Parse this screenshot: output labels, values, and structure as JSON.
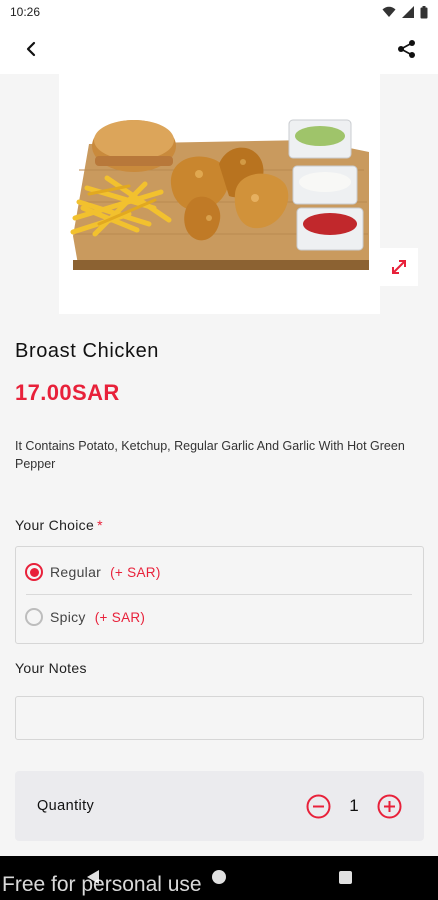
{
  "status_bar": {
    "time": "10:26"
  },
  "product": {
    "name": "Broast Chicken",
    "price": "17.00SAR",
    "description": "It Contains Potato, Ketchup, Regular Garlic And Garlic With Hot Green Pepper"
  },
  "choice": {
    "label": "Your Choice",
    "required_mark": "*",
    "options": [
      {
        "label": "Regular",
        "extra": "(+ SAR)",
        "selected": true
      },
      {
        "label": "Spicy",
        "extra": "(+ SAR)",
        "selected": false
      }
    ]
  },
  "notes": {
    "label": "Your Notes",
    "value": "",
    "placeholder": ""
  },
  "quantity": {
    "label": "Quantity",
    "value": "1"
  },
  "watermark": "Free for personal use",
  "colors": {
    "accent": "#e8213a",
    "background": "#f5f5f5",
    "quantity_bg": "#ebebee"
  },
  "icons": [
    "back-arrow-icon",
    "share-icon",
    "expand-icon",
    "minus-circle-icon",
    "plus-circle-icon",
    "wifi-icon",
    "signal-icon",
    "battery-icon"
  ]
}
